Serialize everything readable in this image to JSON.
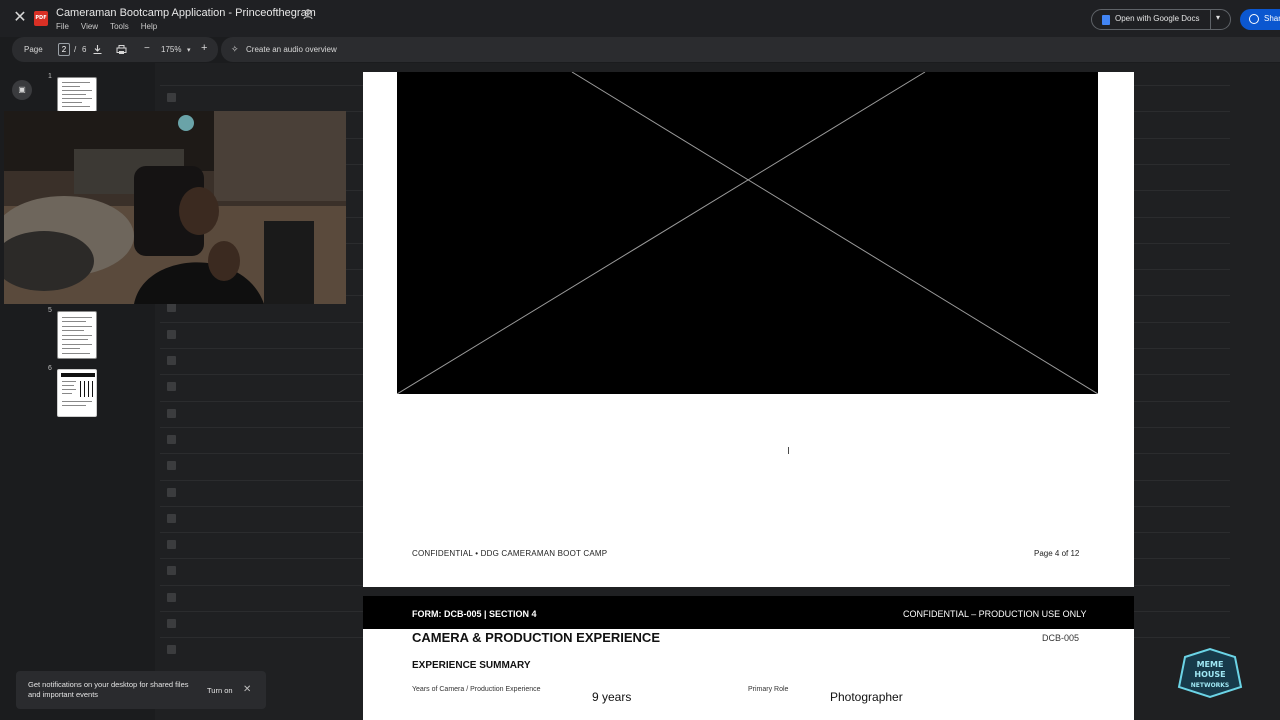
{
  "header": {
    "close_icon": "close-icon",
    "file_badge": "PDF",
    "title": "Cameraman Bootcamp Application  - Princeofthegram",
    "menu": [
      "File",
      "View",
      "Tools",
      "Help"
    ],
    "open_with": "Open with Google Docs",
    "share": "Share"
  },
  "toolbar": {
    "page_label": "Page",
    "page_current": "2",
    "page_sep": "/",
    "page_total": "6",
    "zoom": "175%",
    "audio_overview": "Create an audio overview"
  },
  "thumbnails": [
    {
      "number": "1"
    },
    {
      "number": "5"
    },
    {
      "number": "6"
    }
  ],
  "document": {
    "footer_left": "CONFIDENTIAL • DDG CAMERAMAN BOOT CAMP",
    "footer_right": "Page 4 of 12",
    "form_band_left": "FORM: DCB-005  |  SECTION 4",
    "form_band_right": "CONFIDENTIAL – PRODUCTION USE ONLY",
    "section_title": "CAMERA & PRODUCTION EXPERIENCE",
    "section_code": "DCB-005",
    "subsection": "EXPERIENCE SUMMARY",
    "years_label": "Years of Camera / Production Experience",
    "years_value": "9 years",
    "role_label": "Primary Role",
    "role_value": "Photographer"
  },
  "notification": {
    "message": "Get notifications on your desktop for shared files and important events",
    "action": "Turn on"
  },
  "watermark": {
    "text": "MEME HOUSE NETWORKS"
  }
}
